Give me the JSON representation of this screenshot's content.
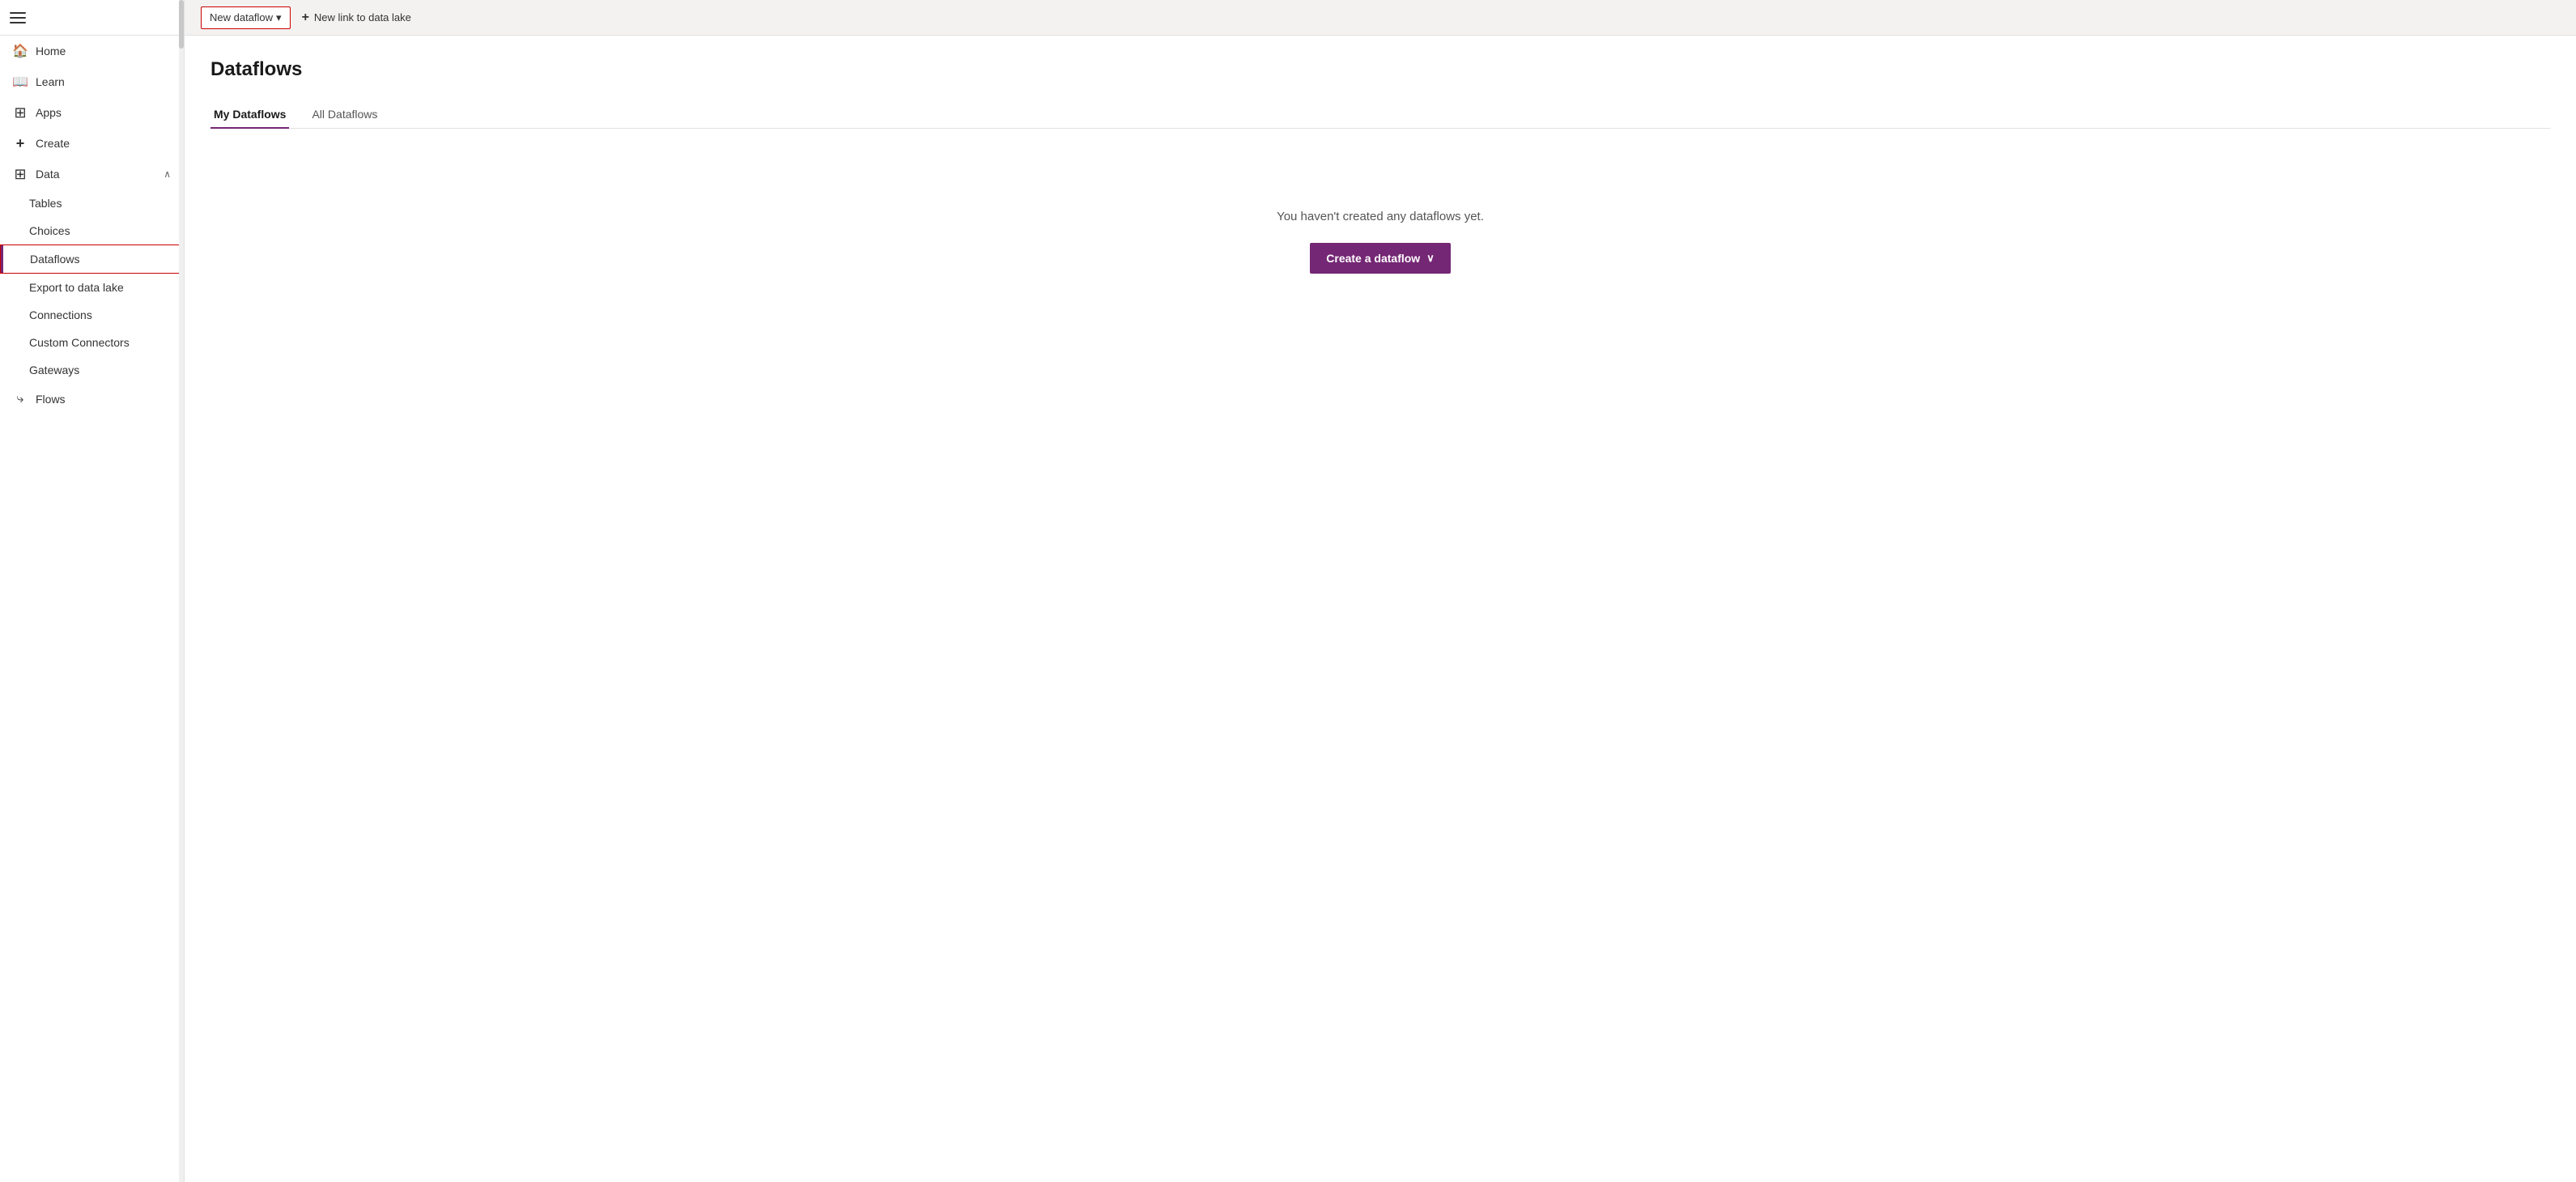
{
  "sidebar": {
    "items": [
      {
        "id": "home",
        "label": "Home",
        "icon": "🏠",
        "type": "nav"
      },
      {
        "id": "learn",
        "label": "Learn",
        "icon": "📖",
        "type": "nav"
      },
      {
        "id": "apps",
        "label": "Apps",
        "icon": "➕",
        "type": "nav"
      },
      {
        "id": "create",
        "label": "Create",
        "icon": "➕",
        "type": "nav"
      },
      {
        "id": "data",
        "label": "Data",
        "icon": "⊞",
        "type": "nav",
        "expanded": true,
        "chevron": "∧"
      }
    ],
    "sub_items": [
      {
        "id": "tables",
        "label": "Tables"
      },
      {
        "id": "choices",
        "label": "Choices"
      },
      {
        "id": "dataflows",
        "label": "Dataflows",
        "active": true
      },
      {
        "id": "export-data-lake",
        "label": "Export to data lake"
      },
      {
        "id": "connections",
        "label": "Connections"
      },
      {
        "id": "custom-connectors",
        "label": "Custom Connectors"
      },
      {
        "id": "gateways",
        "label": "Gateways"
      }
    ],
    "bottom_items": [
      {
        "id": "flows",
        "label": "Flows",
        "icon": "⤷"
      }
    ]
  },
  "toolbar": {
    "new_dataflow_label": "New dataflow",
    "new_link_label": "New link to data lake",
    "dropdown_arrow": "▾",
    "plus_icon": "+"
  },
  "main": {
    "page_title": "Dataflows",
    "tabs": [
      {
        "id": "my-dataflows",
        "label": "My Dataflows",
        "active": true
      },
      {
        "id": "all-dataflows",
        "label": "All Dataflows",
        "active": false
      }
    ],
    "empty_message": "You haven't created any dataflows yet.",
    "create_button_label": "Create a dataflow",
    "create_button_chevron": "∨"
  }
}
